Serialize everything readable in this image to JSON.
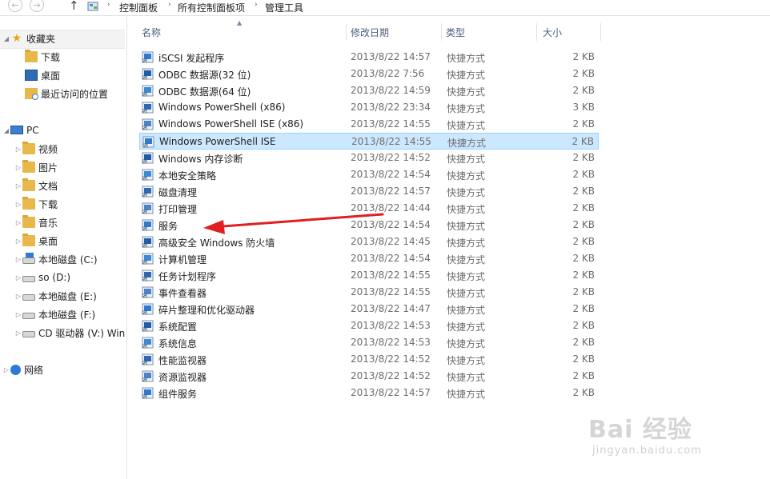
{
  "address_bar": {
    "breadcrumbs": [
      "控制面板",
      "所有控制面板项",
      "管理工具"
    ]
  },
  "nav": {
    "favorites_label": "收藏夹",
    "favorites": [
      "下载",
      "桌面",
      "最近访问的位置"
    ],
    "pc_label": "PC",
    "pc_items": [
      "视频",
      "图片",
      "文档",
      "下载",
      "音乐",
      "桌面",
      "本地磁盘 (C:)",
      "so (D:)",
      "本地磁盘 (E:)",
      "本地磁盘 (F:)",
      "CD 驱动器 (V:) Win"
    ],
    "network_label": "网络"
  },
  "columns": {
    "name": "名称",
    "modified": "修改日期",
    "type": "类型",
    "size": "大小"
  },
  "files": [
    {
      "name": "iSCSI 发起程序",
      "date": "2013/8/22 14:57",
      "type": "快捷方式",
      "size": "2 KB",
      "icon": "iscsi-icon"
    },
    {
      "name": "ODBC 数据源(32 位)",
      "date": "2013/8/22 7:56",
      "type": "快捷方式",
      "size": "2 KB",
      "icon": "odbc-icon"
    },
    {
      "name": "ODBC 数据源(64 位)",
      "date": "2013/8/22 14:59",
      "type": "快捷方式",
      "size": "2 KB",
      "icon": "odbc-icon"
    },
    {
      "name": "Windows PowerShell (x86)",
      "date": "2013/8/22 23:34",
      "type": "快捷方式",
      "size": "3 KB",
      "icon": "powershell-icon"
    },
    {
      "name": "Windows PowerShell ISE (x86)",
      "date": "2013/8/22 14:55",
      "type": "快捷方式",
      "size": "2 KB",
      "icon": "powershell-ise-icon"
    },
    {
      "name": "Windows PowerShell ISE",
      "date": "2013/8/22 14:55",
      "type": "快捷方式",
      "size": "2 KB",
      "icon": "powershell-ise-icon",
      "selected": true
    },
    {
      "name": "Windows 内存诊断",
      "date": "2013/8/22 14:52",
      "type": "快捷方式",
      "size": "2 KB",
      "icon": "memory-diagnostic-icon"
    },
    {
      "name": "本地安全策略",
      "date": "2013/8/22 14:54",
      "type": "快捷方式",
      "size": "2 KB",
      "icon": "security-policy-icon"
    },
    {
      "name": "磁盘清理",
      "date": "2013/8/22 14:57",
      "type": "快捷方式",
      "size": "2 KB",
      "icon": "disk-cleanup-icon"
    },
    {
      "name": "打印管理",
      "date": "2013/8/22 14:44",
      "type": "快捷方式",
      "size": "2 KB",
      "icon": "print-management-icon"
    },
    {
      "name": "服务",
      "date": "2013/8/22 14:54",
      "type": "快捷方式",
      "size": "2 KB",
      "icon": "services-icon"
    },
    {
      "name": "高级安全 Windows 防火墙",
      "date": "2013/8/22 14:45",
      "type": "快捷方式",
      "size": "2 KB",
      "icon": "firewall-icon"
    },
    {
      "name": "计算机管理",
      "date": "2013/8/22 14:54",
      "type": "快捷方式",
      "size": "2 KB",
      "icon": "computer-management-icon"
    },
    {
      "name": "任务计划程序",
      "date": "2013/8/22 14:55",
      "type": "快捷方式",
      "size": "2 KB",
      "icon": "task-scheduler-icon"
    },
    {
      "name": "事件查看器",
      "date": "2013/8/22 14:55",
      "type": "快捷方式",
      "size": "2 KB",
      "icon": "event-viewer-icon"
    },
    {
      "name": "碎片整理和优化驱动器",
      "date": "2013/8/22 14:47",
      "type": "快捷方式",
      "size": "2 KB",
      "icon": "defrag-icon"
    },
    {
      "name": "系统配置",
      "date": "2013/8/22 14:53",
      "type": "快捷方式",
      "size": "2 KB",
      "icon": "system-config-icon"
    },
    {
      "name": "系统信息",
      "date": "2013/8/22 14:53",
      "type": "快捷方式",
      "size": "2 KB",
      "icon": "system-info-icon"
    },
    {
      "name": "性能监视器",
      "date": "2013/8/22 14:52",
      "type": "快捷方式",
      "size": "2 KB",
      "icon": "performance-monitor-icon"
    },
    {
      "name": "资源监视器",
      "date": "2013/8/22 14:52",
      "type": "快捷方式",
      "size": "2 KB",
      "icon": "resource-monitor-icon"
    },
    {
      "name": "组件服务",
      "date": "2013/8/22 14:57",
      "type": "快捷方式",
      "size": "2 KB",
      "icon": "component-services-icon"
    }
  ],
  "watermark": {
    "text": "Bai 经验",
    "url_text": "jingyan.baidu.com"
  },
  "colors": {
    "selection": "#cce8ff",
    "selection_border": "#99d1ff",
    "arrow": "#e02020"
  }
}
